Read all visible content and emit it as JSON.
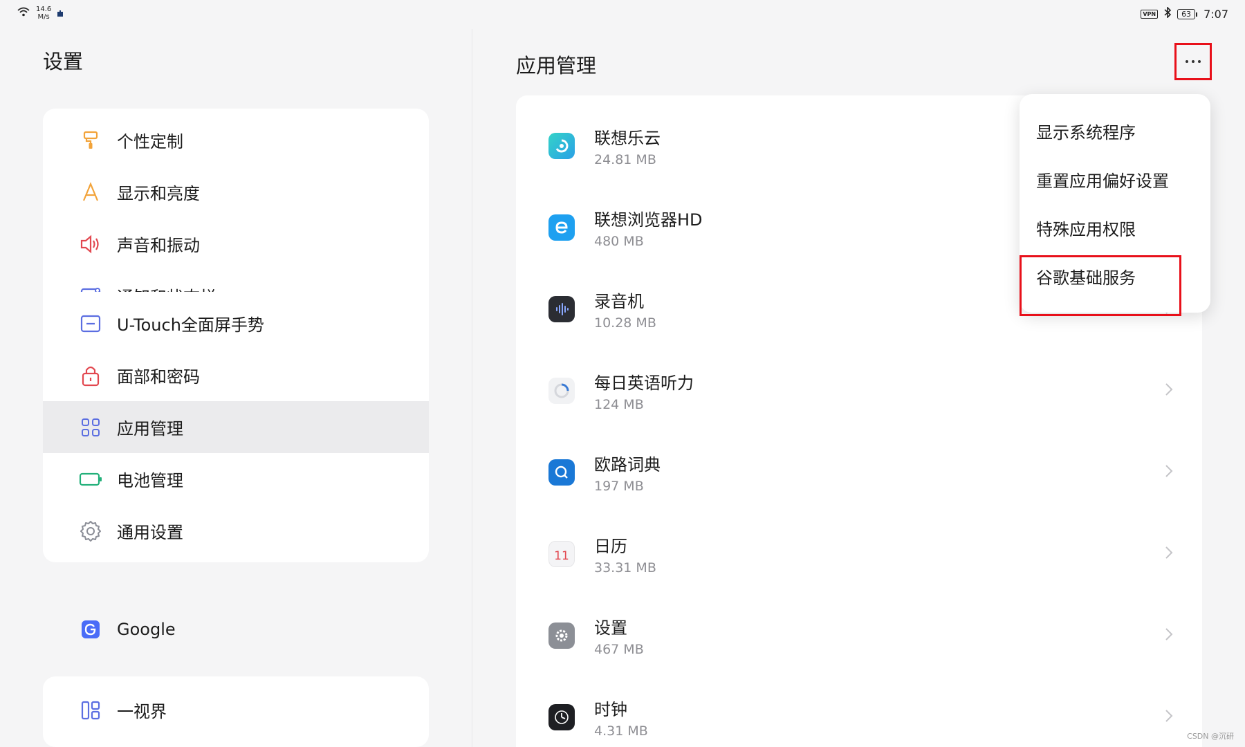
{
  "status_bar": {
    "net_speed_value": "14.6",
    "net_speed_unit": "M/s",
    "vpn_label": "VPN",
    "battery": "63",
    "time": "7:07"
  },
  "left": {
    "title": "设置",
    "groups": [
      {
        "items": [
          {
            "label": "个性定制",
            "icon": "paint-roller-icon"
          },
          {
            "label": "显示和亮度",
            "icon": "font-a-icon"
          },
          {
            "label": "声音和振动",
            "icon": "speaker-icon"
          },
          {
            "label": "通知和状态栏",
            "icon": "notification-icon"
          }
        ]
      },
      {
        "items": [
          {
            "label": "U-Touch全面屏手势",
            "icon": "gesture-icon"
          },
          {
            "label": "面部和密码",
            "icon": "lock-icon"
          },
          {
            "label": "应用管理",
            "icon": "apps-grid-icon",
            "selected": true
          },
          {
            "label": "电池管理",
            "icon": "battery-icon"
          },
          {
            "label": "通用设置",
            "icon": "gear-icon"
          }
        ]
      },
      {
        "items": [
          {
            "label": "Google",
            "icon": "google-icon"
          }
        ]
      },
      {
        "items": [
          {
            "label": "一视界",
            "icon": "layout-icon"
          }
        ]
      }
    ]
  },
  "right": {
    "title": "应用管理",
    "apps": [
      {
        "name": "联想乐云",
        "size": "24.81 MB",
        "icon": "lecloud-icon"
      },
      {
        "name": "联想浏览器HD",
        "size": "480 MB",
        "icon": "browser-icon"
      },
      {
        "name": "录音机",
        "size": "10.28 MB",
        "icon": "recorder-icon"
      },
      {
        "name": "每日英语听力",
        "size": "124 MB",
        "icon": "english-listening-icon"
      },
      {
        "name": "欧路词典",
        "size": "197 MB",
        "icon": "dictionary-icon"
      },
      {
        "name": "日历",
        "size": "33.31 MB",
        "icon": "calendar-icon",
        "calendar_day": "11"
      },
      {
        "name": "设置",
        "size": "467 MB",
        "icon": "settings-app-icon"
      },
      {
        "name": "时钟",
        "size": "4.31 MB",
        "icon": "clock-icon"
      }
    ],
    "menu": [
      "显示系统程序",
      "重置应用偏好设置",
      "特殊应用权限",
      "谷歌基础服务"
    ]
  },
  "colors": {
    "highlight_red": "#e8101a",
    "accent_blue": "#4a6cf7"
  },
  "watermark": "CSDN @沉研"
}
